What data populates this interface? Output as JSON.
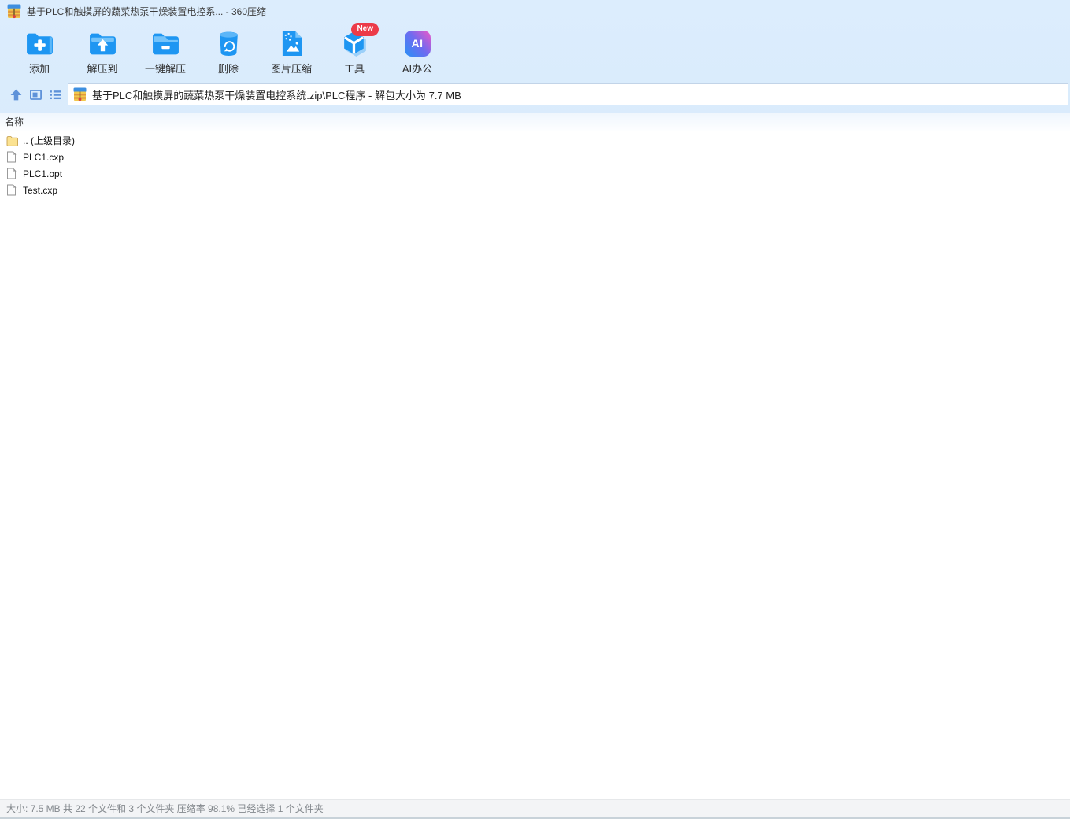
{
  "window": {
    "title": "基于PLC和触摸屏的蔬菜热泵干燥装置电控系... - 360压缩",
    "app_name": "360压缩"
  },
  "toolbar": {
    "buttons": [
      {
        "label": "添加",
        "icon": "add-folder-icon"
      },
      {
        "label": "解压到",
        "icon": "extract-to-icon"
      },
      {
        "label": "一键解压",
        "icon": "one-click-extract-icon"
      },
      {
        "label": "删除",
        "icon": "delete-icon"
      },
      {
        "label": "图片压缩",
        "icon": "image-compress-icon"
      },
      {
        "label": "工具",
        "icon": "tools-cube-icon"
      },
      {
        "label": "AI办公",
        "icon": "ai-office-icon"
      }
    ],
    "new_badge": "New",
    "ai_glyph": "AI"
  },
  "addressbar": {
    "path": "基于PLC和触摸屏的蔬菜热泵干燥装置电控系统.zip\\PLC程序 - 解包大小为 7.7 MB"
  },
  "list": {
    "header": "名称",
    "rows": [
      {
        "name": ".. (上级目录)",
        "icon": "folder-icon"
      },
      {
        "name": "PLC1.cxp",
        "icon": "file-icon"
      },
      {
        "name": "PLC1.opt",
        "icon": "file-icon"
      },
      {
        "name": "Test.cxp",
        "icon": "file-icon"
      }
    ]
  },
  "statusbar": {
    "text": "大小: 7.5 MB 共 22 个文件和 3 个文件夹 压缩率 98.1% 已经选择 1 个文件夹"
  },
  "colors": {
    "accent_blue": "#1e96f2",
    "chrome_blue": "#d2e6fa",
    "badge_red": "#ec3b49",
    "statusbar_bg": "#f3f4f6"
  }
}
